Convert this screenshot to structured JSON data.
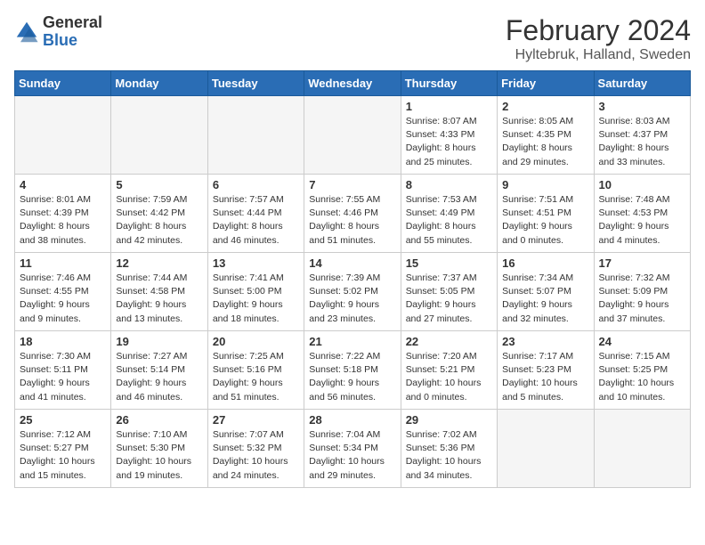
{
  "header": {
    "logo_line1": "General",
    "logo_line2": "Blue",
    "month": "February 2024",
    "location": "Hyltebruk, Halland, Sweden"
  },
  "days_of_week": [
    "Sunday",
    "Monday",
    "Tuesday",
    "Wednesday",
    "Thursday",
    "Friday",
    "Saturday"
  ],
  "weeks": [
    [
      {
        "num": "",
        "info": ""
      },
      {
        "num": "",
        "info": ""
      },
      {
        "num": "",
        "info": ""
      },
      {
        "num": "",
        "info": ""
      },
      {
        "num": "1",
        "info": "Sunrise: 8:07 AM\nSunset: 4:33 PM\nDaylight: 8 hours\nand 25 minutes."
      },
      {
        "num": "2",
        "info": "Sunrise: 8:05 AM\nSunset: 4:35 PM\nDaylight: 8 hours\nand 29 minutes."
      },
      {
        "num": "3",
        "info": "Sunrise: 8:03 AM\nSunset: 4:37 PM\nDaylight: 8 hours\nand 33 minutes."
      }
    ],
    [
      {
        "num": "4",
        "info": "Sunrise: 8:01 AM\nSunset: 4:39 PM\nDaylight: 8 hours\nand 38 minutes."
      },
      {
        "num": "5",
        "info": "Sunrise: 7:59 AM\nSunset: 4:42 PM\nDaylight: 8 hours\nand 42 minutes."
      },
      {
        "num": "6",
        "info": "Sunrise: 7:57 AM\nSunset: 4:44 PM\nDaylight: 8 hours\nand 46 minutes."
      },
      {
        "num": "7",
        "info": "Sunrise: 7:55 AM\nSunset: 4:46 PM\nDaylight: 8 hours\nand 51 minutes."
      },
      {
        "num": "8",
        "info": "Sunrise: 7:53 AM\nSunset: 4:49 PM\nDaylight: 8 hours\nand 55 minutes."
      },
      {
        "num": "9",
        "info": "Sunrise: 7:51 AM\nSunset: 4:51 PM\nDaylight: 9 hours\nand 0 minutes."
      },
      {
        "num": "10",
        "info": "Sunrise: 7:48 AM\nSunset: 4:53 PM\nDaylight: 9 hours\nand 4 minutes."
      }
    ],
    [
      {
        "num": "11",
        "info": "Sunrise: 7:46 AM\nSunset: 4:55 PM\nDaylight: 9 hours\nand 9 minutes."
      },
      {
        "num": "12",
        "info": "Sunrise: 7:44 AM\nSunset: 4:58 PM\nDaylight: 9 hours\nand 13 minutes."
      },
      {
        "num": "13",
        "info": "Sunrise: 7:41 AM\nSunset: 5:00 PM\nDaylight: 9 hours\nand 18 minutes."
      },
      {
        "num": "14",
        "info": "Sunrise: 7:39 AM\nSunset: 5:02 PM\nDaylight: 9 hours\nand 23 minutes."
      },
      {
        "num": "15",
        "info": "Sunrise: 7:37 AM\nSunset: 5:05 PM\nDaylight: 9 hours\nand 27 minutes."
      },
      {
        "num": "16",
        "info": "Sunrise: 7:34 AM\nSunset: 5:07 PM\nDaylight: 9 hours\nand 32 minutes."
      },
      {
        "num": "17",
        "info": "Sunrise: 7:32 AM\nSunset: 5:09 PM\nDaylight: 9 hours\nand 37 minutes."
      }
    ],
    [
      {
        "num": "18",
        "info": "Sunrise: 7:30 AM\nSunset: 5:11 PM\nDaylight: 9 hours\nand 41 minutes."
      },
      {
        "num": "19",
        "info": "Sunrise: 7:27 AM\nSunset: 5:14 PM\nDaylight: 9 hours\nand 46 minutes."
      },
      {
        "num": "20",
        "info": "Sunrise: 7:25 AM\nSunset: 5:16 PM\nDaylight: 9 hours\nand 51 minutes."
      },
      {
        "num": "21",
        "info": "Sunrise: 7:22 AM\nSunset: 5:18 PM\nDaylight: 9 hours\nand 56 minutes."
      },
      {
        "num": "22",
        "info": "Sunrise: 7:20 AM\nSunset: 5:21 PM\nDaylight: 10 hours\nand 0 minutes."
      },
      {
        "num": "23",
        "info": "Sunrise: 7:17 AM\nSunset: 5:23 PM\nDaylight: 10 hours\nand 5 minutes."
      },
      {
        "num": "24",
        "info": "Sunrise: 7:15 AM\nSunset: 5:25 PM\nDaylight: 10 hours\nand 10 minutes."
      }
    ],
    [
      {
        "num": "25",
        "info": "Sunrise: 7:12 AM\nSunset: 5:27 PM\nDaylight: 10 hours\nand 15 minutes."
      },
      {
        "num": "26",
        "info": "Sunrise: 7:10 AM\nSunset: 5:30 PM\nDaylight: 10 hours\nand 19 minutes."
      },
      {
        "num": "27",
        "info": "Sunrise: 7:07 AM\nSunset: 5:32 PM\nDaylight: 10 hours\nand 24 minutes."
      },
      {
        "num": "28",
        "info": "Sunrise: 7:04 AM\nSunset: 5:34 PM\nDaylight: 10 hours\nand 29 minutes."
      },
      {
        "num": "29",
        "info": "Sunrise: 7:02 AM\nSunset: 5:36 PM\nDaylight: 10 hours\nand 34 minutes."
      },
      {
        "num": "",
        "info": ""
      },
      {
        "num": "",
        "info": ""
      }
    ]
  ]
}
